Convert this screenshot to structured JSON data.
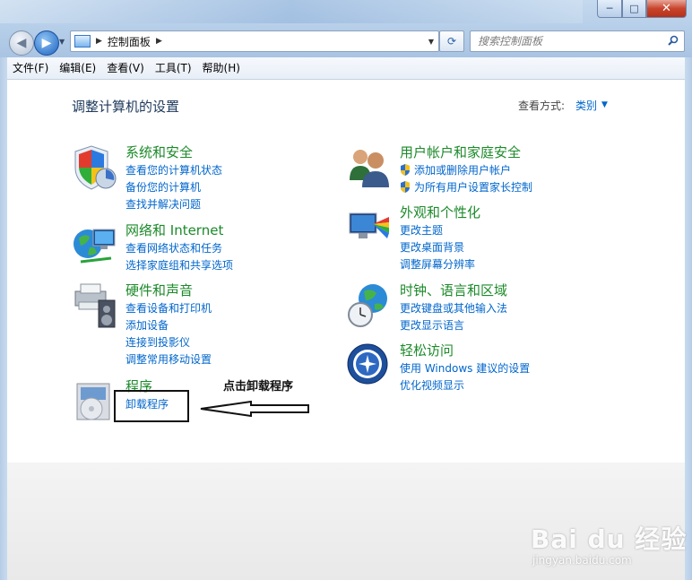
{
  "window": {
    "caption": {
      "minimize": "─",
      "maximize": "□",
      "close": "✕"
    }
  },
  "nav": {
    "back_icon": "back-arrow-icon",
    "forward_icon": "forward-arrow-icon",
    "breadcrumb": "控制面板",
    "search_placeholder": "搜索控制面板"
  },
  "menu": [
    "文件(F)",
    "编辑(E)",
    "查看(V)",
    "工具(T)",
    "帮助(H)"
  ],
  "main": {
    "title": "调整计算机的设置",
    "view_by_label": "查看方式:",
    "view_by_value": "类别"
  },
  "categories_left": [
    {
      "title": "系统和安全",
      "icon": "system-security-icon",
      "links": [
        "查看您的计算机状态",
        "备份您的计算机",
        "查找并解决问题"
      ]
    },
    {
      "title": "网络和 Internet",
      "icon": "network-icon",
      "links": [
        "查看网络状态和任务",
        "选择家庭组和共享选项"
      ]
    },
    {
      "title": "硬件和声音",
      "icon": "hardware-sound-icon",
      "links": [
        "查看设备和打印机",
        "添加设备",
        "连接到投影仪",
        "调整常用移动设置"
      ]
    },
    {
      "title": "程序",
      "icon": "programs-icon",
      "links": [
        "卸载程序"
      ]
    }
  ],
  "categories_right": [
    {
      "title": "用户帐户和家庭安全",
      "icon": "users-icon",
      "links": [
        "添加或删除用户帐户",
        "为所有用户设置家长控制"
      ],
      "shielded": [
        true,
        true
      ]
    },
    {
      "title": "外观和个性化",
      "icon": "appearance-icon",
      "links": [
        "更改主题",
        "更改桌面背景",
        "调整屏幕分辨率"
      ]
    },
    {
      "title": "时钟、语言和区域",
      "icon": "clock-globe-icon",
      "links": [
        "更改键盘或其他输入法",
        "更改显示语言"
      ]
    },
    {
      "title": "轻松访问",
      "icon": "ease-of-access-icon",
      "links": [
        "使用 Windows 建议的设置",
        "优化视频显示"
      ]
    }
  ],
  "annotation": {
    "text": "点击卸载程序"
  },
  "watermark": {
    "main": "Bai du 经验",
    "sub": "jingyan.baidu.com"
  }
}
